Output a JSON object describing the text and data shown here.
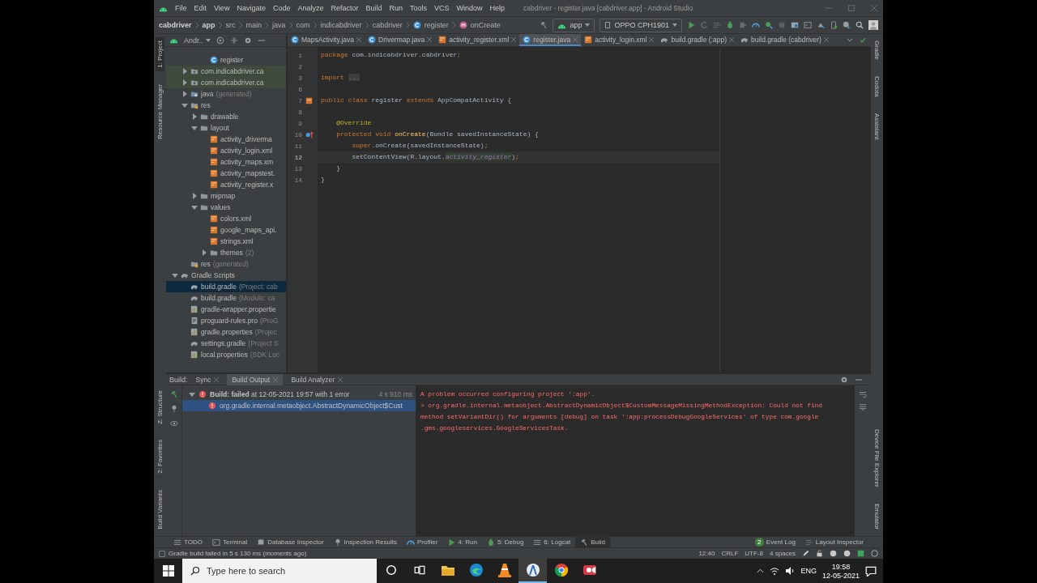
{
  "window": {
    "title": "cabdriver - register.java [cabdriver.app] - Android Studio"
  },
  "menu": [
    "File",
    "Edit",
    "View",
    "Navigate",
    "Code",
    "Analyze",
    "Refactor",
    "Build",
    "Run",
    "Tools",
    "VCS",
    "Window",
    "Help"
  ],
  "breadcrumbs": [
    {
      "label": "cabdriver",
      "kind": "module"
    },
    {
      "label": "app",
      "kind": "module"
    },
    {
      "label": "src",
      "kind": "dir"
    },
    {
      "label": "main",
      "kind": "dir"
    },
    {
      "label": "java",
      "kind": "dir"
    },
    {
      "label": "com",
      "kind": "dir"
    },
    {
      "label": "indicabdriver",
      "kind": "dir"
    },
    {
      "label": "cabdriver",
      "kind": "dir"
    },
    {
      "label": "register",
      "kind": "class"
    },
    {
      "label": "onCreate",
      "kind": "method"
    }
  ],
  "run_config": {
    "module": "app",
    "device": "OPPO CPH1901"
  },
  "left_tool_windows_top": [
    {
      "label": "1: Project",
      "selected": true
    },
    {
      "label": "Resource Manager",
      "selected": false
    }
  ],
  "left_tool_windows_bottom": [
    {
      "label": "Z: Structure",
      "selected": false
    },
    {
      "label": "2: Favorites",
      "selected": false
    },
    {
      "label": "Build Variants",
      "selected": false
    }
  ],
  "right_tool_windows_top": [
    "Gradle",
    "Codota",
    "Assistant"
  ],
  "right_tool_windows_bottom": [
    "Device File Explorer",
    "Emulator"
  ],
  "project_panel": {
    "view": "Andr..",
    "tree": [
      {
        "children": [
          {
            "children": [
              {
                "children": [
                  {
                    "label": "register",
                    "kind": "class",
                    "selected": false
                  }
                ]
              }
            ]
          },
          {
            "label": "com.indicabdriver.ca",
            "kind": "package",
            "expanded": false,
            "selected": false,
            "color": "#3e4a3c"
          },
          {
            "label": "com.indicabdriver.ca",
            "kind": "package",
            "expanded": false,
            "selected": false,
            "color": "#3e4a3c"
          },
          {
            "label": "java",
            "suffix": "(generated)",
            "kind": "generated",
            "expanded": false,
            "selected": false
          },
          {
            "label": "res",
            "kind": "res",
            "expanded": true,
            "selected": false,
            "children": [
              {
                "label": "drawable",
                "kind": "folder",
                "expanded": false,
                "selected": false
              },
              {
                "label": "layout",
                "kind": "folder",
                "expanded": true,
                "selected": false,
                "children": [
                  {
                    "label": "activity_driverma",
                    "kind": "xml",
                    "selected": false
                  },
                  {
                    "label": "activity_login.xml",
                    "kind": "xml",
                    "selected": false
                  },
                  {
                    "label": "activity_maps.xm",
                    "kind": "xml",
                    "selected": false
                  },
                  {
                    "label": "activity_mapstest.",
                    "kind": "xml",
                    "selected": false
                  },
                  {
                    "label": "activity_register.x",
                    "kind": "xml",
                    "selected": false
                  }
                ]
              },
              {
                "label": "mipmap",
                "kind": "folder",
                "expanded": false,
                "selected": false
              },
              {
                "label": "values",
                "kind": "folder",
                "expanded": true,
                "selected": false,
                "children": [
                  {
                    "label": "colors.xml",
                    "kind": "xml",
                    "selected": false
                  },
                  {
                    "label": "google_maps_api.",
                    "kind": "xml",
                    "selected": false
                  },
                  {
                    "label": "strings.xml",
                    "kind": "xml",
                    "selected": false
                  },
                  {
                    "label": "themes",
                    "suffix": "(2)",
                    "kind": "folder",
                    "expanded": false,
                    "selected": false
                  }
                ]
              }
            ]
          },
          {
            "label": "res",
            "suffix": "(generated)",
            "kind": "res",
            "selected": false
          }
        ]
      },
      {
        "label": "Gradle Scripts",
        "kind": "gradle",
        "expanded": true,
        "selected": false,
        "children": [
          {
            "label": "build.gradle",
            "suffix": "(Project: cab",
            "kind": "gradle",
            "selected": true
          },
          {
            "label": "build.gradle",
            "suffix": "(Module: ca",
            "kind": "gradle",
            "selected": false
          },
          {
            "label": "gradle-wrapper.propertie",
            "kind": "properties",
            "selected": false
          },
          {
            "label": "proguard-rules.pro",
            "suffix": "(ProG",
            "kind": "text",
            "selected": false
          },
          {
            "label": "gradle.properties",
            "suffix": "(Projec",
            "kind": "properties",
            "selected": false
          },
          {
            "label": "settings.gradle",
            "suffix": "(Project S",
            "kind": "gradle",
            "selected": false
          },
          {
            "label": "local.properties",
            "suffix": "(SDK Loc",
            "kind": "properties",
            "selected": false
          }
        ]
      }
    ]
  },
  "editor": {
    "tabs": [
      {
        "label": "MapsActivity.java",
        "kind": "class",
        "selected": false
      },
      {
        "label": "Drivermap.java",
        "kind": "class",
        "selected": false
      },
      {
        "label": "activity_register.xml",
        "kind": "xml",
        "selected": false
      },
      {
        "label": "register.java",
        "kind": "class",
        "selected": true
      },
      {
        "label": "activity_login.xml",
        "kind": "xml",
        "selected": false
      },
      {
        "label": "build.gradle (:app)",
        "kind": "gradle",
        "selected": false
      },
      {
        "label": "build.gradle (cabdriver)",
        "kind": "gradle",
        "selected": false
      }
    ],
    "lines": [
      {
        "number": "1",
        "current": false,
        "segments": [
          {
            "text": "package",
            "kind": "keyword"
          },
          {
            "text": " com.indicabdriver.cabdriver",
            "kind": "plain"
          },
          {
            "text": ";",
            "kind": "keyword"
          }
        ]
      },
      {
        "number": "2",
        "current": false
      },
      {
        "number": "3",
        "current": false,
        "segments": [
          {
            "text": "import",
            "kind": "keyword"
          },
          {
            "text": "...",
            "kind": "fold"
          }
        ]
      },
      {
        "number": "6",
        "current": false
      },
      {
        "number": "7",
        "current": false,
        "kind": "layout",
        "segments": [
          {
            "text": "public class ",
            "kind": "keyword"
          },
          {
            "text": "register ",
            "kind": "plain"
          },
          {
            "text": "extends ",
            "kind": "keyword"
          },
          {
            "text": "AppCompatActivity {",
            "kind": "plain"
          }
        ]
      },
      {
        "number": "8",
        "current": false
      },
      {
        "number": "9",
        "current": false,
        "segments": [
          {
            "text": "    @Override",
            "kind": "annotation"
          }
        ]
      },
      {
        "number": "10",
        "current": false,
        "kind": "override",
        "segments": [
          {
            "text": "    protected void ",
            "kind": "keyword"
          },
          {
            "text": "onCreate",
            "kind": "method"
          },
          {
            "text": "(Bundle savedInstanceState) {",
            "kind": "plain"
          }
        ]
      },
      {
        "number": "11",
        "current": false,
        "segments": [
          {
            "text": "        super",
            "kind": "keyword"
          },
          {
            "text": ".onCreate(savedInstanceState)",
            "kind": "plain"
          },
          {
            "text": ";",
            "kind": "keyword"
          }
        ]
      },
      {
        "number": "12",
        "current": true,
        "segments": [
          {
            "text": "        setContentView(R.layout.",
            "kind": "plain"
          },
          {
            "text": "activity_register",
            "kind": "field"
          },
          {
            "text": ")",
            "kind": "plain"
          },
          {
            "text": ";",
            "kind": "keyword"
          }
        ]
      },
      {
        "number": "13",
        "current": false,
        "segments": [
          {
            "text": "    }",
            "kind": "plain"
          }
        ]
      },
      {
        "number": "14",
        "current": false,
        "segments": [
          {
            "text": "}",
            "kind": "plain"
          }
        ]
      }
    ]
  },
  "build": {
    "label": "Build:",
    "tabs": [
      {
        "label": "Sync",
        "selected": false
      },
      {
        "label": "Build Output",
        "selected": true
      },
      {
        "label": "Build Analyzer",
        "selected": false
      }
    ],
    "tree": [
      {
        "label": "**Build: failed** at 12-05-2021 19:57 with 1 error",
        "time": "4 s 910 ms",
        "expanded": true,
        "selected": false,
        "children": [
          {
            "label": "org.gradle.internal.metaobject.AbstractDynamicObject$Cust",
            "selected": true
          }
        ]
      }
    ],
    "console": [
      "A problem occurred configuring project ':app'.",
      "> org.gradle.internal.metaobject.AbstractDynamicObject$CustomMessageMissingMethodException: Could not find",
      "method setVariantDir() for arguments [debug] on task ':app:processDebugGoogleServices' of type com.google",
      ".gms.googleservices.GoogleServicesTask."
    ]
  },
  "bottom_tool_windows": [
    {
      "label": "TODO",
      "kind": "list",
      "selected": false
    },
    {
      "label": "Terminal",
      "kind": "terminal",
      "selected": false
    },
    {
      "label": "Database Inspector",
      "kind": "database",
      "selected": false
    },
    {
      "label": "Inspection Results",
      "kind": "pin",
      "selected": false
    },
    {
      "label": "Profiler",
      "kind": "gauge",
      "selected": false
    },
    {
      "label": "4: Run",
      "kind": "run",
      "selected": false
    },
    {
      "label": "5: Debug",
      "kind": "bug",
      "selected": false
    },
    {
      "label": "6: Logcat",
      "kind": "list",
      "selected": false
    },
    {
      "label": "Build",
      "kind": "hammer",
      "selected": true
    }
  ],
  "right_bottom_tools": [
    {
      "label": "Event Log",
      "badge": "2"
    },
    {
      "label": "Layout Inspector"
    }
  ],
  "status_bar": {
    "message": "Gradle build failed in 5 s 130 ms (moments ago)",
    "items": [
      "12:40",
      "CRLF",
      "UTF-8",
      "4 spaces"
    ]
  },
  "taskbar": {
    "search": {
      "placeholder": "Type here to search"
    },
    "apps": [
      {
        "kind": "folder",
        "selected": false
      },
      {
        "kind": "edge",
        "selected": false
      },
      {
        "kind": "cone",
        "selected": false
      },
      {
        "kind": "studio",
        "selected": true
      },
      {
        "kind": "chrome",
        "selected": false
      },
      {
        "kind": "recorder",
        "selected": false
      }
    ],
    "language": "ENG",
    "time": "19:58",
    "date": "12-05-2021"
  }
}
